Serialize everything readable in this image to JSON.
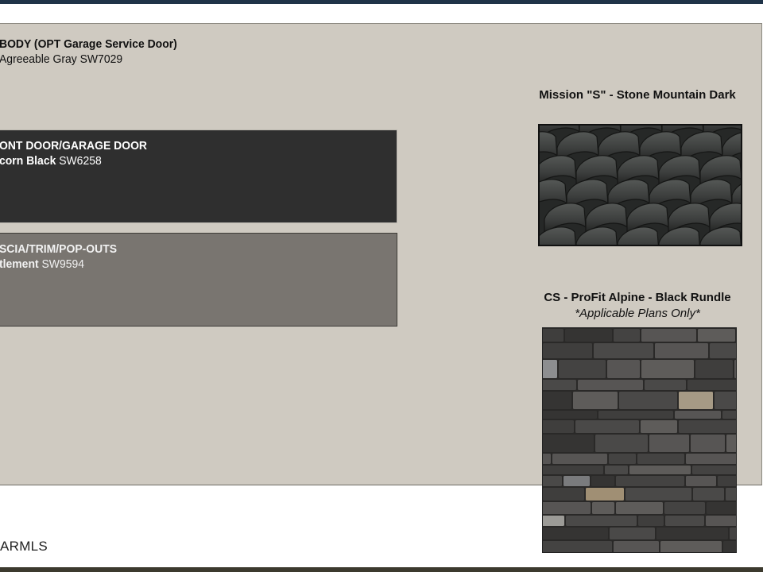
{
  "body": {
    "title": "BODY (OPT Garage Service Door)",
    "color_name": "Agreeable Gray",
    "color_code": "SW7029"
  },
  "front_door": {
    "title": "ONT DOOR/GARAGE DOOR",
    "color_name": "corn Black",
    "color_code": "SW6258"
  },
  "fascia": {
    "title": "SCIA/TRIM/POP-OUTS",
    "color_name": "tlement",
    "color_code": "SW9594"
  },
  "roof": {
    "title": "Mission \"S\" - Stone Mountain Dark"
  },
  "stone": {
    "title": "CS - ProFit Alpine - Black Rundle",
    "note": "*Applicable Plans Only*"
  },
  "watermark": "ARMLS",
  "colors": {
    "board": "#cfcac1",
    "front_door_swatch": "#2f2f2f",
    "fascia_swatch": "#797570",
    "top_bar": "#1f3348"
  },
  "icons": {
    "roof_sample": "roof-tile-image",
    "stone_sample": "stacked-stone-image"
  }
}
